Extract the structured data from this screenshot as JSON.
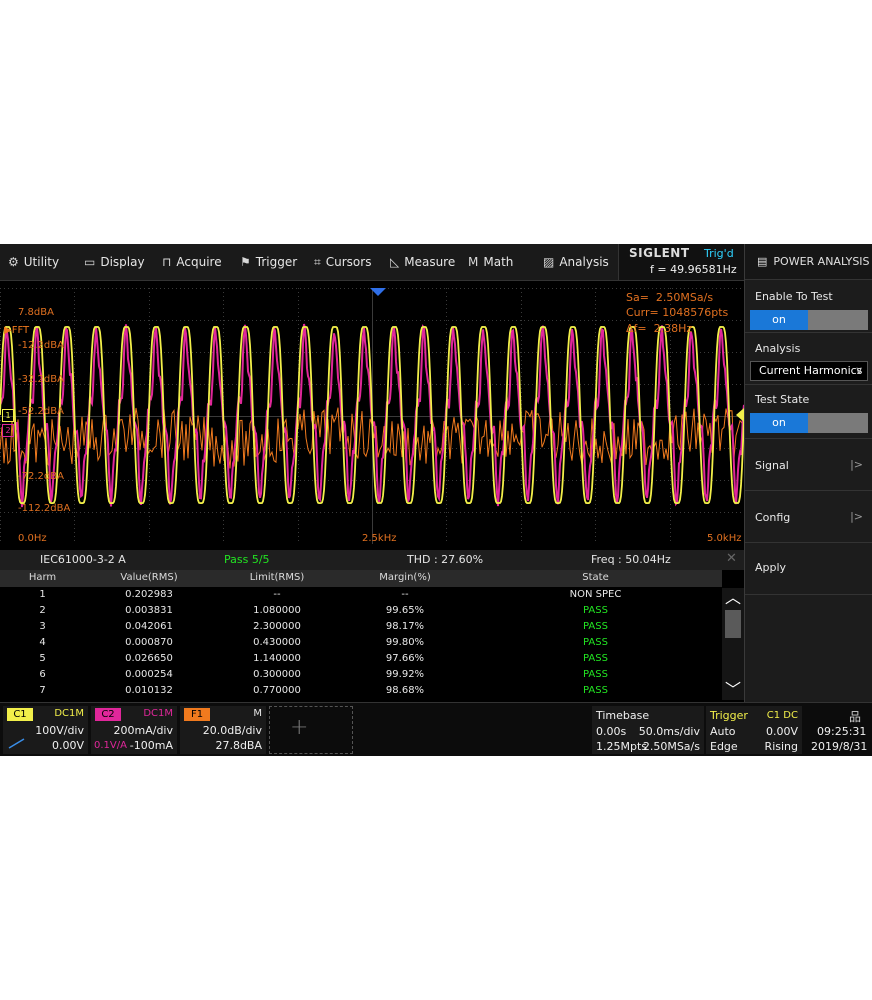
{
  "menu": {
    "items": [
      {
        "icon": "gear-icon",
        "glyph": "⚙",
        "label": "Utility"
      },
      {
        "icon": "monitor-icon",
        "glyph": "▭",
        "label": "Display"
      },
      {
        "icon": "acquire-icon",
        "glyph": "⊓",
        "label": "Acquire"
      },
      {
        "icon": "flag-icon",
        "glyph": "⚑",
        "label": "Trigger"
      },
      {
        "icon": "crosshair-icon",
        "glyph": "⌗",
        "label": "Cursors"
      },
      {
        "icon": "measure-icon",
        "glyph": "◺",
        "label": "Measure"
      },
      {
        "icon": "math-icon",
        "glyph": "M",
        "label": "Math"
      },
      {
        "icon": "analysis-icon",
        "glyph": "▨",
        "label": "Analysis"
      }
    ]
  },
  "brand": {
    "logo": "SIGLENT",
    "trig_status": "Trig'd",
    "frequency": "f = 49.96581Hz"
  },
  "right_panel": {
    "title": "POWER ANALYSIS",
    "enable_label": "Enable To Test",
    "enable_state": "on",
    "analysis_label": "Analysis",
    "analysis_value": "Current Harmonics",
    "test_state_label": "Test State",
    "test_state_value": "on",
    "signal_label": "Signal",
    "config_label": "Config",
    "apply_label": "Apply"
  },
  "waveform": {
    "fft_label": "FFT",
    "ref_top": "7.8dBA",
    "ref_2": "-12.2dBA",
    "ref_3": "-32.2dBA",
    "ref_4": "-52.2dBA",
    "ref_5": "-72.2dBA",
    "ref_bottom": "-112.2dBA",
    "x_start": "0.0Hz",
    "x_mid": "2.5kHz",
    "x_end": "5.0kHz",
    "sa": "Sa=  2.50MSa/s",
    "curr": "Curr= 1048576pts",
    "df": "Δf=  2.38Hz",
    "ch1_marker": "1",
    "ch2_marker": "2",
    "colors": {
      "ch1": "#f2ef4a",
      "ch2": "#e0279a",
      "fft": "#f07a1e",
      "grid": "#3a3a3a"
    }
  },
  "table": {
    "standard": "IEC61000-3-2 A",
    "pass_summary": "Pass 5/5",
    "thd": "THD : 27.60%",
    "freq": "Freq : 50.04Hz",
    "columns": [
      "Harm",
      "Value(RMS)",
      "Limit(RMS)",
      "Margin(%)",
      "State"
    ],
    "rows": [
      {
        "harm": "1",
        "value": "0.202983",
        "limit": "--",
        "margin": "--",
        "state": "NON SPEC"
      },
      {
        "harm": "2",
        "value": "0.003831",
        "limit": "1.080000",
        "margin": "99.65%",
        "state": "PASS"
      },
      {
        "harm": "3",
        "value": "0.042061",
        "limit": "2.300000",
        "margin": "98.17%",
        "state": "PASS"
      },
      {
        "harm": "4",
        "value": "0.000870",
        "limit": "0.430000",
        "margin": "99.80%",
        "state": "PASS"
      },
      {
        "harm": "5",
        "value": "0.026650",
        "limit": "1.140000",
        "margin": "97.66%",
        "state": "PASS"
      },
      {
        "harm": "6",
        "value": "0.000254",
        "limit": "0.300000",
        "margin": "99.92%",
        "state": "PASS"
      },
      {
        "harm": "7",
        "value": "0.010132",
        "limit": "0.770000",
        "margin": "98.68%",
        "state": "PASS"
      }
    ]
  },
  "bottom": {
    "c1": {
      "tag": "C1",
      "coupling": "DC1M",
      "scale": "100V/div",
      "offset": "0.00V"
    },
    "c2": {
      "tag": "C2",
      "coupling": "DC1M",
      "scale": "200mA/div",
      "probe": "0.1V/A",
      "offset": "-100mA"
    },
    "f1": {
      "tag": "F1",
      "mode": "M",
      "scale": "20.0dB/div",
      "offset": "27.8dBA"
    },
    "timebase": {
      "label": "Timebase",
      "delay": "0.00s",
      "scale": "50.0ms/div",
      "points": "1.25Mpts",
      "rate": "2.50MSa/s"
    },
    "trigger": {
      "label": "Trigger",
      "source": "C1 DC",
      "mode": "Auto",
      "level": "0.00V",
      "type": "Edge",
      "slope": "Rising"
    },
    "clock": {
      "time": "09:25:31",
      "date": "2019/8/31"
    }
  }
}
